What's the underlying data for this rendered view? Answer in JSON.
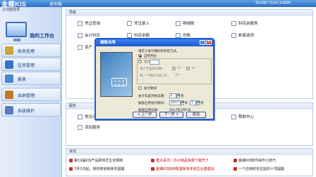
{
  "app": {
    "logo_text": "金蝶KIS",
    "edition": "迷你版",
    "top_links": "常见问题  产品论坛  在线帮助",
    "accent": "#2d6dc1"
  },
  "sidebar": {
    "title": "主功能选项",
    "my_work": "我的工作台",
    "items": [
      {
        "label": "账务处理",
        "icon": "ledger-icon",
        "color": "#c8a43a"
      },
      {
        "label": "往来管理",
        "icon": "contacts-icon",
        "color": "#3a6fc8"
      },
      {
        "label": "报表",
        "icon": "report-icon",
        "color": "#4a86d0"
      },
      {
        "label": "出纳管理",
        "icon": "cashier-icon",
        "color": "#c07a2a"
      },
      {
        "label": "系统维护",
        "icon": "maintenance-icon",
        "color": "#5a7ab8"
      }
    ]
  },
  "nav_panel": {
    "title": "导航",
    "items": [
      "凭证查询",
      "凭证录入",
      "明细账",
      "科目余额表",
      "会计科目",
      "科目余额",
      "总账",
      "帐套选项",
      "资产"
    ]
  },
  "service_panel": {
    "title": "服务",
    "items": [
      "常见问题",
      "添加服务",
      "帮助中心"
    ]
  },
  "news_panel": {
    "title": "资讯",
    "items": [
      "第19届KIS产品即将迁生全网购",
      "重大喜讯！办公用品免费下载开了",
      "金蝶KIS软件操作小技巧",
      "7月1日起，常财修道到账务提醒",
      "金蝶KIS如何配置帐务年结生业套建议",
      "一个应用财务总监的十项提醒"
    ]
  },
  "dialog": {
    "title": "建账向导",
    "prompt": "请定义会计期间的界定方式。",
    "option_natural": "自然月份",
    "option_custom": "会计期间",
    "periods_label": "会计年度期间数：",
    "periods_value": "12",
    "days_label": "每一个期间天数(日)：",
    "days_value": "29",
    "radio_13": "13",
    "radio_14": "14",
    "start_year_label": "会计年度开始日期：",
    "start_month_label": "账套启用会计期间：",
    "start_date_label": "账套启用日期：",
    "year_value": "2017",
    "year_unit": "年",
    "month_value": "1",
    "month_unit": "月",
    "start_date_value": "2017年1月1日",
    "back_button": "< 上一步",
    "next_button": "下一步 >",
    "cancel_button": "取消",
    "help_button": "?"
  }
}
